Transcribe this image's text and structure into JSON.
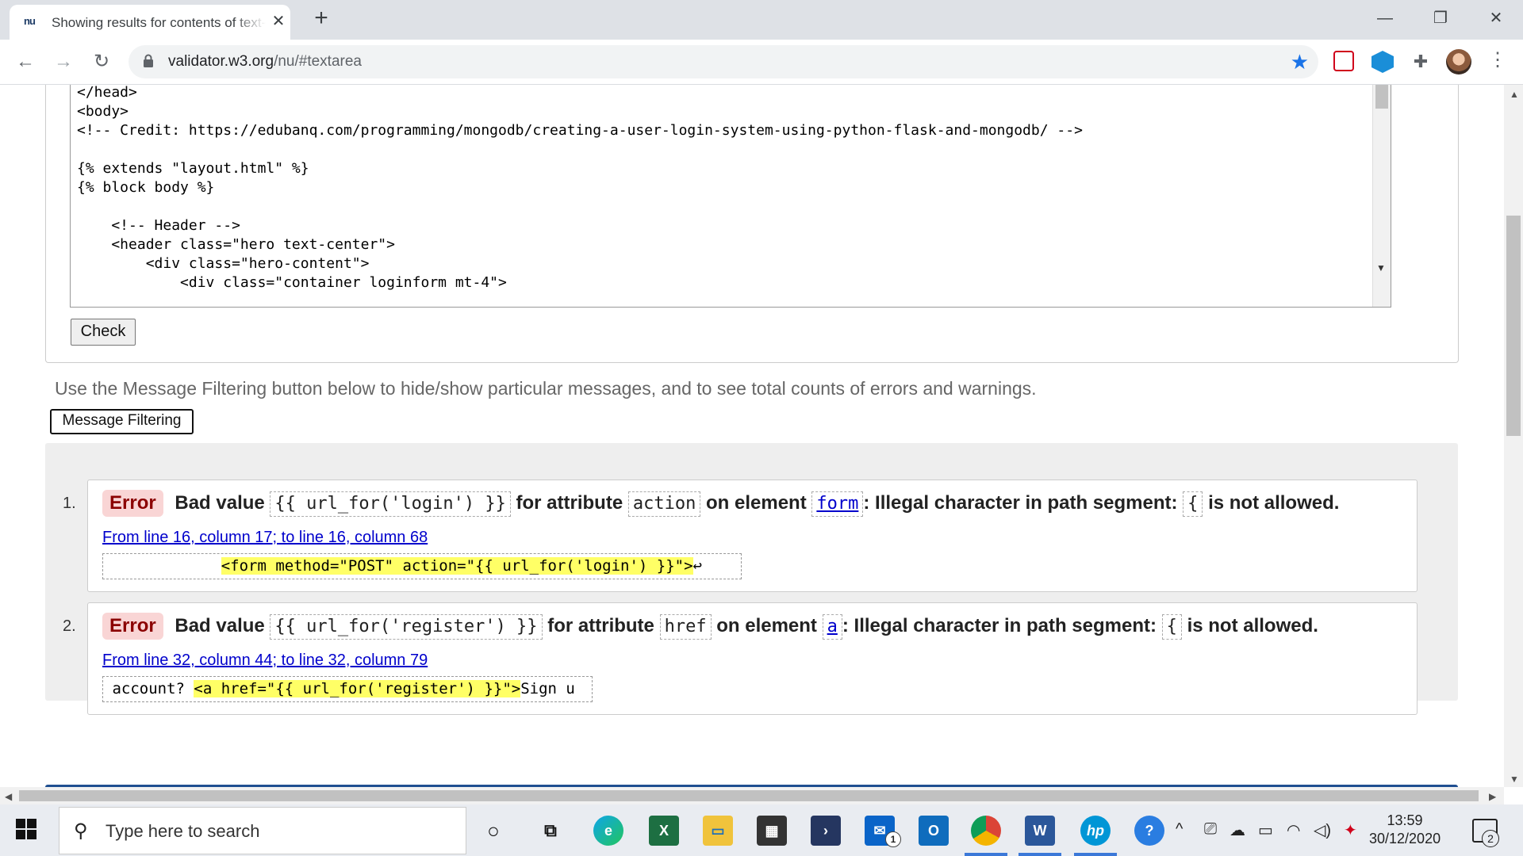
{
  "browser": {
    "tab_title": "Showing results for contents of text-input area - Nu Html Checker",
    "favicon_text": "nu",
    "url_host": "validator.w3.org",
    "url_path": "/nu/#textarea"
  },
  "textarea": {
    "lines": [
      "</head>",
      "<body>",
      "<!-- Credit: https://edubanq.com/programming/mongodb/creating-a-user-login-system-using-python-flask-and-mongodb/ -->",
      "",
      "{% extends \"layout.html\" %}",
      "{% block body %}",
      "",
      "    <!-- Header -->",
      "    <header class=\"hero text-center\">",
      "        <div class=\"hero-content\">",
      "            <div class=\"container loginform mt-4\">"
    ]
  },
  "check_button": "Check",
  "filter_hint": "Use the Message Filtering button below to hide/show particular messages, and to see total counts of errors and warnings.",
  "filter_button": "Message Filtering",
  "messages": [
    {
      "number": "1.",
      "type": "Error",
      "text_bad_value": "Bad value",
      "value": "{{ url_for('login') }}",
      "text_for_attr": "for attribute",
      "attribute": "action",
      "text_on_element": "on element",
      "element": "form",
      "text_illegal": ": Illegal character in path segment:",
      "char": "{",
      "text_not_allowed": "is not allowed.",
      "location": "From line 16, column 17; to line 16, column 68",
      "extract_pre": "             ",
      "extract_hl": "<form method=\"POST\" action=\"{{ url_for('login') }}\">",
      "extract_post": "↩"
    },
    {
      "number": "2.",
      "type": "Error",
      "text_bad_value": "Bad value",
      "value": "{{ url_for('register') }}",
      "text_for_attr": "for attribute",
      "attribute": "href",
      "text_on_element": "on element",
      "element": "a",
      "text_illegal": ": Illegal character in path segment:",
      "char": "{",
      "text_not_allowed": "is not allowed.",
      "location": "From line 32, column 44; to line 32, column 79",
      "extract_pre": " account? ",
      "extract_hl": "<a href=\"{{ url_for('register') }}\">",
      "extract_post": "Sign u"
    }
  ],
  "taskbar": {
    "search_placeholder": "Type here to search",
    "time": "13:59",
    "date": "30/12/2020",
    "notification_count": "2",
    "mail_badge": "1"
  },
  "colors": {
    "error_badge_bg": "#f9d5d5",
    "highlight": "#ffff66",
    "link": "#0000cc",
    "accent_bar": "#1f4f90"
  }
}
